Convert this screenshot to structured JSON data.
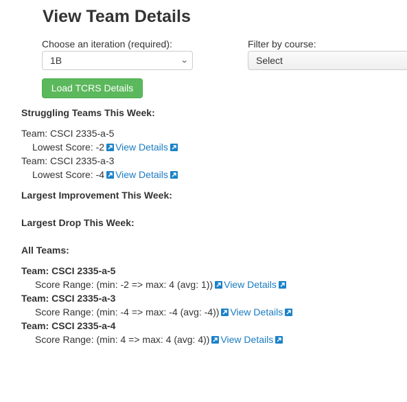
{
  "page": {
    "title": "View Team Details"
  },
  "iteration": {
    "label": "Choose an iteration (required):",
    "selected": "1B"
  },
  "course": {
    "label": "Filter by course:",
    "selected": "Select"
  },
  "load_button": "Load TCRS Details",
  "struggling": {
    "heading": "Struggling Teams This Week:",
    "teams": [
      {
        "team": "Team: CSCI 2335-a-5",
        "score": "Lowest Score: -2",
        "link": "View Details"
      },
      {
        "team": "Team: CSCI 2335-a-3",
        "score": "Lowest Score: -4",
        "link": "View Details"
      }
    ]
  },
  "improvement": {
    "heading": "Largest Improvement This Week:"
  },
  "drop": {
    "heading": "Largest Drop This Week:"
  },
  "all_teams": {
    "heading": "All Teams:",
    "teams": [
      {
        "team": "Team: CSCI 2335-a-5",
        "range": "Score Range: (min: -2 => max: 4 (avg: 1))",
        "link": "View Details"
      },
      {
        "team": "Team: CSCI 2335-a-3",
        "range": "Score Range: (min: -4 => max: -4 (avg: -4))",
        "link": "View Details"
      },
      {
        "team": "Team: CSCI 2335-a-4",
        "range": "Score Range: (min: 4 => max: 4 (avg: 4))",
        "link": "View Details"
      }
    ]
  },
  "colors": {
    "button_green": "#5cb85c",
    "link_blue": "#1a7bc2",
    "icon_blue": "#1a82c9"
  },
  "icons": {
    "external_link": "external-link-icon",
    "dropdown": "chevron-down-icon"
  }
}
